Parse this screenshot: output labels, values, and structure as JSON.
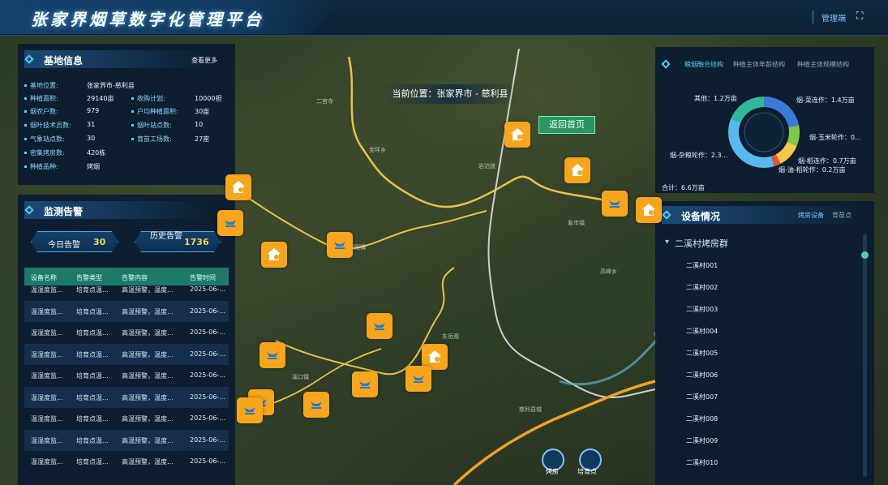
{
  "header": {
    "title": "张家界烟草数字化管理平台",
    "admin_label": "管理端",
    "fullscreen_icon": "fullscreen-icon"
  },
  "base_info": {
    "title": "基地信息",
    "more": "查看更多",
    "left": [
      {
        "k": "基地位置:",
        "v": "张家界市-慈利县"
      },
      {
        "k": "种植面积:",
        "v": "29140亩"
      },
      {
        "k": "烟农户数:",
        "v": "979"
      },
      {
        "k": "烟叶技术员数:",
        "v": "31"
      },
      {
        "k": "气象站点数:",
        "v": "30"
      },
      {
        "k": "密集烤房数:",
        "v": "420栋"
      },
      {
        "k": "种植品种:",
        "v": "烤烟"
      }
    ],
    "right": [
      {
        "k": "收购计划:",
        "v": "10000担"
      },
      {
        "k": "户均种植面积:",
        "v": "30亩"
      },
      {
        "k": "烟叶站点数:",
        "v": "10"
      },
      {
        "k": "育苗工场数:",
        "v": "27座"
      }
    ]
  },
  "alarm": {
    "title": "监测告警",
    "today_label": "今日告警",
    "today_count": "30",
    "history_label": "历史告警",
    "history_count": "1736",
    "columns": [
      "设备名称",
      "告警类型",
      "告警内容",
      "告警时间"
    ],
    "rows": [
      [
        "温湿度监...",
        "培育点温...",
        "高温预警，温度...",
        "2025-06-..."
      ],
      [
        "温湿度监...",
        "培育点温...",
        "高温预警，温度...",
        "2025-06-..."
      ],
      [
        "温湿度监...",
        "培育点温...",
        "高温预警，温度...",
        "2025-06-..."
      ],
      [
        "温湿度监...",
        "培育点温...",
        "高温预警，温度...",
        "2025-06-..."
      ],
      [
        "温湿度监...",
        "培育点温...",
        "高温预警，温度...",
        "2025-06-..."
      ],
      [
        "温湿度监...",
        "培育点温...",
        "高温预警，温度...",
        "2025-06-..."
      ],
      [
        "温湿度监...",
        "培育点温...",
        "高温预警，温度...",
        "2025-06-..."
      ],
      [
        "温湿度监...",
        "培育点温...",
        "高温预警，温度...",
        "2025-06-..."
      ],
      [
        "温湿度监...",
        "培育点温...",
        "高温预警，温度...",
        "2025-06-..."
      ]
    ]
  },
  "structure": {
    "tabs": [
      "粮烟融合结构",
      "种植主体年龄结构",
      "种植主体规模结构"
    ],
    "total": "合计：6.6万亩",
    "segments": [
      {
        "label": "烟-菜连作：1.4万亩",
        "value": 1.4,
        "color": "#3b7bd8"
      },
      {
        "label": "烟-玉米轮作：0...",
        "value": 0.6,
        "color": "#7cc94a"
      },
      {
        "label": "烟-稻连作：0.7万亩",
        "value": 0.7,
        "color": "#f2c84b"
      },
      {
        "label": "烟-油-稻轮作：0.2万亩",
        "value": 0.2,
        "color": "#e5533d"
      },
      {
        "label": "烟-杂粮轮作：2.3...",
        "value": 2.3,
        "color": "#5ab8f0"
      },
      {
        "label": "其他：1.2万亩",
        "value": 1.2,
        "color": "#2fb89a"
      }
    ]
  },
  "devices": {
    "title": "设备情况",
    "tabs": [
      "烤房设备",
      "育苗点"
    ],
    "group": "二溪村烤房群",
    "items": [
      "二溪村001",
      "二溪村002",
      "二溪村003",
      "二溪村004",
      "二溪村005",
      "二溪村006",
      "二溪村007",
      "二溪村008",
      "二溪村009",
      "二溪村010"
    ]
  },
  "map": {
    "location": "当前位置：张家界市 - 慈利县",
    "back": "返回首页",
    "bottom": [
      "烤房",
      "培育点"
    ]
  }
}
